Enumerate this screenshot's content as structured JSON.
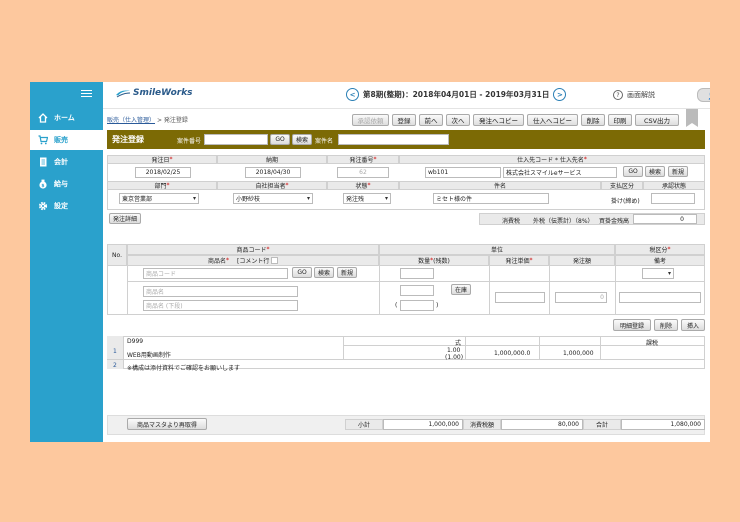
{
  "sidebar": {
    "items": [
      {
        "label": "ホーム",
        "icon": "home-icon"
      },
      {
        "label": "販売",
        "icon": "cart-icon"
      },
      {
        "label": "会計",
        "icon": "ledger-icon"
      },
      {
        "label": "給与",
        "icon": "money-bag-icon"
      },
      {
        "label": "設定",
        "icon": "gear-icon"
      }
    ],
    "active": "販売",
    "color": "#2aa1cc"
  },
  "header": {
    "logo": "SmileWorks",
    "period": "第8期(整期)：2018年04月01日 - 2019年03月31日",
    "help": "画面解説"
  },
  "breadcrumb": {
    "link": "販売（仕入管理）",
    "sep": ">",
    "current": "発注登録"
  },
  "toolbar": {
    "approve": "承認依頼",
    "register": "登録",
    "prev": "前へ",
    "next": "次へ",
    "copy_to_order": "発注へコピー",
    "copy_to_purchase": "仕入へコピー",
    "delete": "削除",
    "print": "印刷",
    "csv": "CSV出力"
  },
  "title_bar": {
    "title": "発注登録",
    "case_no_label": "案件番号",
    "go": "GO",
    "search": "検索",
    "case_name_label": "案件名",
    "color": "#7c6a05"
  },
  "form": {
    "order_date_label": "発注日",
    "order_date": "2018/02/25",
    "delivery_label": "納期",
    "delivery": "2018/04/30",
    "order_no_label": "発注番号",
    "order_no": "62",
    "supplier_label": "仕入先コード * 仕入先名",
    "supplier_code": "wb101",
    "supplier_name": "株式会社スマイルeサービス",
    "go": "GO",
    "search": "検索",
    "new": "新規",
    "dept_label": "部門",
    "dept": "東京営業部",
    "staff_label": "自社担当者",
    "staff": "小野紗枝",
    "status_label": "状態",
    "status": "発注残",
    "subject_label": "件名",
    "subject": "ミセト様の件",
    "payment_type_label": "支払区分",
    "payment_type": "掛け(締め)",
    "approval_label": "承認状態",
    "detail_button": "発注詳細",
    "tax_label": "消費税",
    "tax_method": "外税（伝票計）（8%）",
    "buy_balance_label": "買掛金残高",
    "buy_balance": "0"
  },
  "line_entry": {
    "no_label": "No.",
    "product_code_label": "商品コード",
    "product_name_label": "商品名",
    "comment_label": "[コメント行",
    "unit_label": "単位",
    "qty_label": "数量",
    "qty_sub": "(残数)",
    "price_label": "発注単価",
    "amount_label": "発注額",
    "tax_class_label": "税区分",
    "remarks_label": "備考",
    "code_placeholder": "商品コード",
    "name_placeholder": "商品名",
    "name2_placeholder": "商品名 (下段)",
    "go": "GO",
    "search": "検索",
    "new": "新規",
    "stock": "在庫",
    "amount_value": "0",
    "paren_open": "(",
    "paren_close": ")",
    "register_button": "明細登録",
    "delete_button": "削除",
    "insert_button": "挿入"
  },
  "lines": [
    {
      "no": "1",
      "code": "D999",
      "name": "WEB用動画制作",
      "unit": "式",
      "qty": "1.00",
      "remain": "(1.00)",
      "price": "1,000,000.0",
      "amount": "1,000,000",
      "tax": "課税"
    },
    {
      "no": "2",
      "name": "※構成は添付資料でご確認をお願いします"
    }
  ],
  "footer": {
    "reload_button": "商品マスタより再取得",
    "subtotal_label": "小計",
    "subtotal": "1,000,000",
    "tax_label": "消費税額",
    "tax": "80,000",
    "total_label": "合計",
    "total": "1,080,000"
  }
}
